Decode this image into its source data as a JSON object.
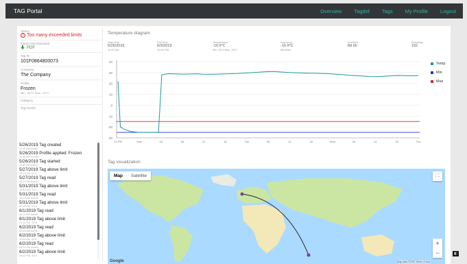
{
  "app": {
    "title": "TAG Portal"
  },
  "nav": [
    "Overview",
    "Tagdef",
    "Tags",
    "My Profile",
    "Logout"
  ],
  "left": {
    "status_label": "Status",
    "status_value": "Too many exceeded limits",
    "report_label": "Export and download",
    "pdf_label": "PDF",
    "tag_label": "Tag ID",
    "tag_value": "101F0864800073",
    "company_label": "Company",
    "company_value": "The Company",
    "profile_label": "Profile",
    "profile_value": "Frozen",
    "profile_note": "Min: -25°C, Max: -15°C",
    "category_label": "Category",
    "events_label": "Tag events",
    "events": [
      {
        "title": "5/26/2019 Tag created",
        "sub": "11:45 AM    Admin"
      },
      {
        "title": "5/26/2019 Profile applied: Frozen",
        "sub": "11:46 AM    Frozen"
      },
      {
        "title": "5/26/2019 Tag started",
        "sub": "11:50 AM    Admin"
      },
      {
        "title": "5/27/2019 Tag above limit",
        "sub": "06:14 AM    -11.5"
      },
      {
        "title": "5/27/2019 Tag read",
        "sub": "08:22 AM    Admin"
      },
      {
        "title": "5/31/2019 Tag above limit",
        "sub": "09:40 AM    -11.0"
      },
      {
        "title": "5/31/2019 Tag read",
        "sub": "10:02 AM    Admin"
      },
      {
        "title": "5/31/2019 Tag above limit",
        "sub": "02:15 PM    -10.8"
      },
      {
        "title": "6/1/2019 Tag read",
        "sub": "09:11 AM    Admin"
      },
      {
        "title": "6/1/2019 Tag above limit",
        "sub": "01:30 PM    -10.5"
      },
      {
        "title": "6/2/2019 Tag read",
        "sub": "08:05 AM    Admin"
      },
      {
        "title": "6/2/2019 Tag above limit",
        "sub": "11:44 AM    -10.4"
      },
      {
        "title": "6/2/2019 Tag read",
        "sub": "03:20 PM    Admin"
      },
      {
        "title": "6/2/2019 Tag above limit",
        "sub": "06:02 PM    -10.2"
      }
    ]
  },
  "chart_section": {
    "title": "Temperature diagram",
    "stats": [
      {
        "label": "Start time",
        "value": "5/26/2019",
        "sub": "11:50 AM"
      },
      {
        "label": "End time",
        "value": "6/3/2019",
        "sub": "12:00 PM"
      },
      {
        "label": "Temperature",
        "value": "-10.9°C",
        "sub": "Min -25.0 Max -15.0"
      },
      {
        "label": "Avg temp",
        "value": "-10.9°C",
        "sub": "Min/Max"
      },
      {
        "label": "Duration",
        "value": "8d 0h",
        "sub": ""
      },
      {
        "label": "Readings",
        "value": "192",
        "sub": ""
      }
    ]
  },
  "chart_data": {
    "type": "line",
    "ylim": [
      -30,
      40
    ],
    "yticks": [
      40,
      30,
      20,
      10,
      0,
      -10,
      -20,
      -30
    ],
    "xticks": [
      "12 PM",
      "Mon",
      "18",
      "06",
      "12",
      "18",
      "Tue",
      "06",
      "12",
      "18",
      "Wed",
      "06",
      "12",
      "18",
      "Thu"
    ],
    "series": [
      {
        "name": "Temp",
        "color": "#1a9a9a",
        "values": [
          22,
          -20,
          -22,
          -24,
          -25,
          -25,
          -25,
          28,
          29,
          28.8,
          28.6,
          28.7,
          28.9,
          28.5,
          28.4,
          28.6,
          28.8,
          29,
          29.2,
          29.6,
          30,
          30.4,
          30.8,
          31,
          30.6,
          30.2,
          29.9,
          29.7,
          29.5,
          29.4,
          29.2,
          29,
          28.6,
          28.2,
          27.6,
          27.2,
          26.8,
          26.4,
          26.3,
          26.6,
          27,
          27.4,
          27.2,
          27,
          27.2
        ]
      },
      {
        "name": "Min",
        "color": "#1f2fe0",
        "values": [
          -25
        ]
      },
      {
        "name": "Max",
        "color": "#d6252a",
        "values": [
          -15
        ]
      }
    ],
    "xlabel": "",
    "ylabel": "",
    "legend": "right",
    "grid": true
  },
  "map_section": {
    "title": "Tag visualization",
    "tab_map": "Map",
    "tab_satellite": "Satellite",
    "fullscreen": "⛶",
    "zoom_in": "+",
    "zoom_out": "−",
    "google": "Google",
    "attribution": "Map data ©2019  Terms of Use"
  }
}
